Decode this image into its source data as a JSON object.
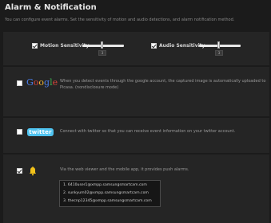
{
  "page": {
    "title": "Alarm & Notification",
    "description": "You can configure event alarms. Set the sensitivity of motion and audio detections, and alarm notification method."
  },
  "sensitivity": {
    "motion": {
      "label": "Motion Sensitivity",
      "checked": true,
      "value": "3",
      "level_fraction": 0.5
    },
    "audio": {
      "label": "Audio Sensitivity",
      "checked": true,
      "value": "3",
      "level_fraction": 0.5
    }
  },
  "google": {
    "logo_letters": [
      "G",
      "o",
      "o",
      "g",
      "l",
      "e"
    ],
    "logo_colors": [
      "#4a7de8",
      "#d9443a",
      "#f2b632",
      "#4a7de8",
      "#3aa64a",
      "#d9443a"
    ],
    "checked": false,
    "text_line1": "When you detect events through the google account, the captured image is automatically uploaded to",
    "text_line2": "Picasa. (nondisclosure mode)"
  },
  "twitter": {
    "logo_text": "twitter",
    "logo_color": "#4fc3f0",
    "checked": false,
    "text": "Connect with twitter so that you can receive event information on your twitter account."
  },
  "push": {
    "checked": true,
    "icon": "bell-icon",
    "text": "Via the web viewer and the mobile app, it provides push alarms.",
    "emails": [
      "1. 6410user1@xmpp.samsungsmartcam.com",
      "2. sunkyum02@xmpp.samsungsmartcam.com",
      "3. thecnp12345@xmpp.samsungsmartcam.com"
    ]
  },
  "colors": {
    "background": "#1b1b1b",
    "panel": "#252525",
    "bell": "#f2c21a"
  }
}
